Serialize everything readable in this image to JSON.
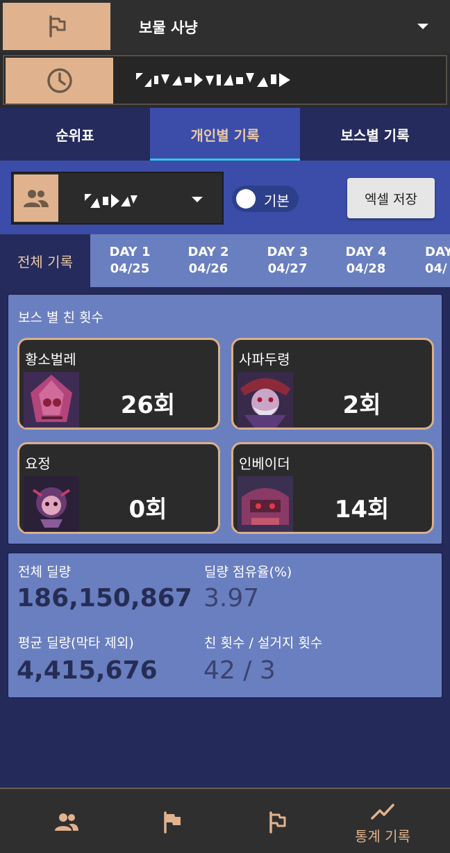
{
  "header": {
    "mode_label": "보물 사냥",
    "mode_icon": "flag-outline-icon",
    "time_icon": "clock-icon"
  },
  "tabs": [
    {
      "label": "순위표",
      "active": false
    },
    {
      "label": "개인별 기록",
      "active": true
    },
    {
      "label": "보스별 기록",
      "active": false
    }
  ],
  "filter": {
    "user_icon": "people-icon",
    "toggle_label": "기본",
    "excel_label": "엑셀 저장"
  },
  "day_tabs": {
    "all_label": "전체 기록",
    "days": [
      {
        "day": "DAY 1",
        "date": "04/25"
      },
      {
        "day": "DAY 2",
        "date": "04/26"
      },
      {
        "day": "DAY 3",
        "date": "04/27"
      },
      {
        "day": "DAY 4",
        "date": "04/28"
      },
      {
        "day": "DAY",
        "date": "04/"
      }
    ]
  },
  "boss_section": {
    "title": "보스 별 친 횟수",
    "bosses": [
      {
        "name": "황소벌레",
        "count": "26회"
      },
      {
        "name": "사파두령",
        "count": "2회"
      },
      {
        "name": "요정",
        "count": "0회"
      },
      {
        "name": "인베이더",
        "count": "14회"
      }
    ]
  },
  "stats": {
    "total_damage_label": "전체 딜량",
    "total_damage": "186,150,867",
    "share_label": "딜량 점유율(%)",
    "share": "3.97",
    "avg_label": "평균 딜량(막타 제외)",
    "avg": "4,415,676",
    "hits_label": "친 횟수 / 설거지 횟수",
    "hits": "42 / 3"
  },
  "bottom_nav": {
    "items": [
      {
        "icon": "people-icon",
        "label": ""
      },
      {
        "icon": "flag-icon",
        "label": ""
      },
      {
        "icon": "flag-outline-icon",
        "label": ""
      },
      {
        "icon": "trending-up-icon",
        "label": "통계 기록"
      }
    ]
  },
  "colors": {
    "accent": "#e0b38e",
    "tab_underline": "#30c8e8",
    "primary": "#3b4da8",
    "card": "#6a7fc0"
  }
}
